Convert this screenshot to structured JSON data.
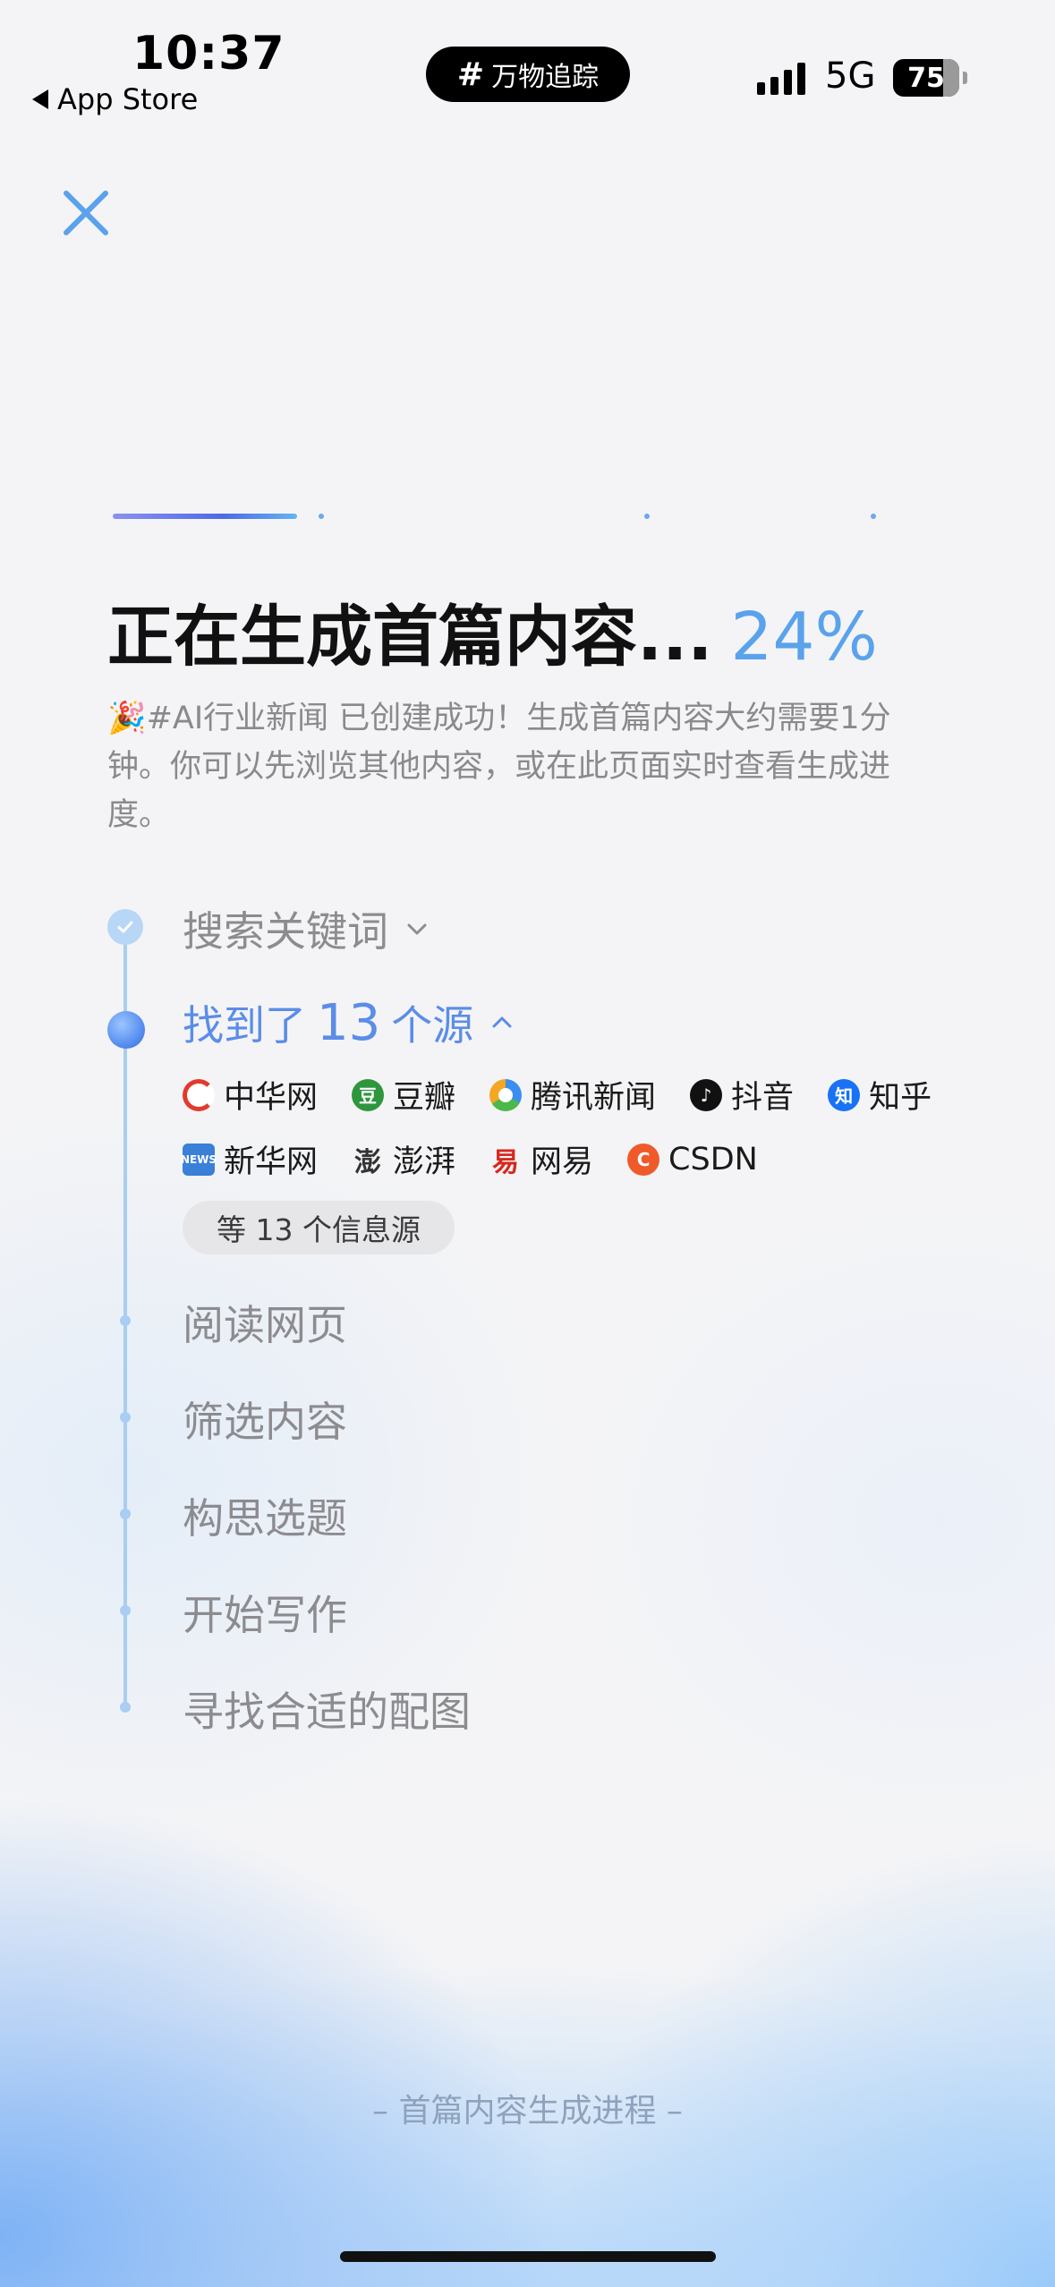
{
  "status_bar": {
    "time": "10:37",
    "back_label": "App Store",
    "island_label": "万物追踪",
    "network": "5G",
    "battery": "75"
  },
  "progress": {
    "title": "正在生成首篇内容...",
    "percent": "24%",
    "fraction": 0.24,
    "description": "🎉#AI行业新闻 已创建成功！生成首篇内容大约需要1分钟。你可以先浏览其他内容，或在此页面实时查看生成进度。"
  },
  "steps": {
    "search_keywords": "搜索关键词",
    "found_prefix": "找到了",
    "found_count": "13",
    "found_suffix": "个源",
    "read_pages": "阅读网页",
    "filter_content": "筛选内容",
    "plan_topics": "构思选题",
    "start_writing": "开始写作",
    "find_images": "寻找合适的配图"
  },
  "sources": [
    {
      "name": "中华网",
      "icon": "zhonghua-icon",
      "color": "#e23a2e"
    },
    {
      "name": "豆瓣",
      "icon": "douban-icon",
      "color": "#2e963d"
    },
    {
      "name": "腾讯新闻",
      "icon": "tencent-news-icon",
      "color": "#3a8ef0"
    },
    {
      "name": "抖音",
      "icon": "douyin-icon",
      "color": "#111111"
    },
    {
      "name": "知乎",
      "icon": "zhihu-icon",
      "color": "#1772f6"
    },
    {
      "name": "新华网",
      "icon": "xinhua-icon",
      "color": "#3a7fd8"
    },
    {
      "name": "澎湃",
      "icon": "pengpai-icon",
      "color": "#333333"
    },
    {
      "name": "网易",
      "icon": "netease-icon",
      "color": "#d7281e"
    },
    {
      "name": "CSDN",
      "icon": "csdn-icon",
      "color": "#f05a2a"
    }
  ],
  "more_sources": "等 13 个信息源",
  "footer": "– 首篇内容生成进程 –",
  "colors": {
    "accent": "#5aa2ec",
    "active_step": "#5b8de8",
    "timeline": "#a9cdf3"
  }
}
